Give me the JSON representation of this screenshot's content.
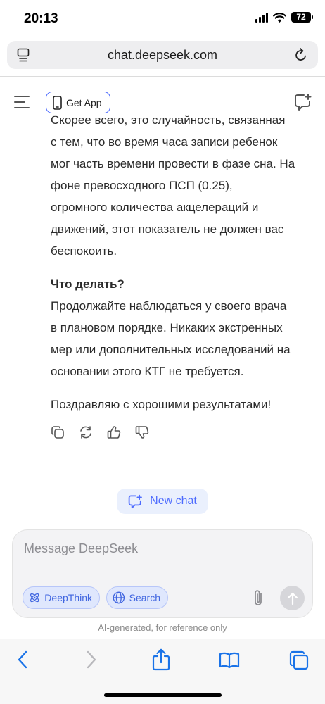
{
  "status": {
    "time": "20:13",
    "battery": "72"
  },
  "browser": {
    "url": "chat.deepseek.com"
  },
  "header": {
    "get_app_label": "Get App"
  },
  "message": {
    "paragraph1_lines": [
      "Скорее всего, это случайность, связанная",
      "с тем, что во время часа записи ребенок",
      "мог часть времени провести в фазе сна. На",
      "фоне превосходного ПСП (0.25),",
      "огромного количества акцелераций и",
      "движений, этот показатель не должен вас",
      "беспокоить."
    ],
    "heading": "Что делать?",
    "paragraph2_lines": [
      "Продолжайте наблюдаться у своего врача",
      "в плановом порядке. Никаких экстренных",
      "мер или дополнительных исследований на",
      "основании этого КТГ не требуется."
    ],
    "closing": "Поздравляю с хорошими результатами!"
  },
  "new_chat_label": "New chat",
  "composer": {
    "placeholder": "Message DeepSeek",
    "deepthink_label": "DeepThink",
    "search_label": "Search"
  },
  "disclaimer": "AI-generated, for reference only",
  "colors": {
    "accent": "#4d6bfe",
    "chip_bg": "#dfe7fd",
    "pill_bg": "#eaf0fd"
  },
  "icons": [
    "reader-icon",
    "reload-icon",
    "menu-icon",
    "phone-icon",
    "new-chat-icon",
    "copy-icon",
    "regenerate-icon",
    "thumbs-up-icon",
    "thumbs-down-icon",
    "atom-icon",
    "globe-icon",
    "paperclip-icon",
    "arrow-up-icon",
    "back-icon",
    "forward-icon",
    "share-icon",
    "bookmarks-icon",
    "tabs-icon"
  ]
}
